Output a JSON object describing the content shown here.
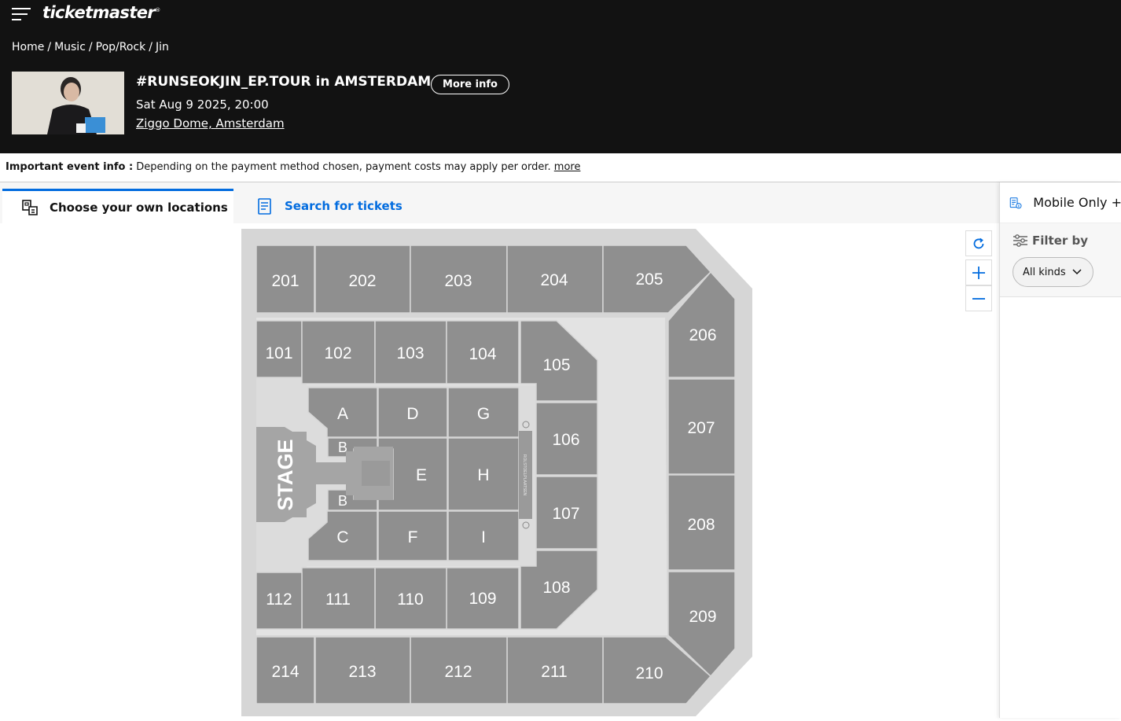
{
  "header": {
    "logo_text": "ticketmaster",
    "logo_reg": "®",
    "breadcrumb": [
      "Home",
      "Music",
      "Pop/Rock",
      "Jin"
    ],
    "event_title": "#RUNSEOKJIN_EP.TOUR in AMSTERDAM",
    "more_info_label": "More info",
    "event_date": "Sat Aug 9 2025, 20:00",
    "event_venue": "Ziggo Dome, Amsterdam"
  },
  "info_bar": {
    "label": "Important event info :",
    "text": " Depending on the payment method chosen, payment costs may apply per order. ",
    "link": "more"
  },
  "tabs": [
    {
      "label": "Choose your own locations",
      "active": true
    },
    {
      "label": "Search for tickets",
      "active": false
    }
  ],
  "right_panel": {
    "top_label": "Mobile Only +",
    "filter_label": "Filter by",
    "filter_value": "All kinds"
  },
  "colors": {
    "header_bg": "#121212",
    "accent": "#026cdf",
    "section_fill": "#8f8f8f",
    "floor_fill": "#d6d6d6"
  },
  "seat_map": {
    "stage_label": "STAGE",
    "side_label": "ROLSTOELPLAATSEN",
    "sections": {
      "s201": "201",
      "s202": "202",
      "s203": "203",
      "s204": "204",
      "s205": "205",
      "s206": "206",
      "s207": "207",
      "s208": "208",
      "s209": "209",
      "s210": "210",
      "s211": "211",
      "s212": "212",
      "s213": "213",
      "s214": "214",
      "s101": "101",
      "s102": "102",
      "s103": "103",
      "s104": "104",
      "s105": "105",
      "s106": "106",
      "s107": "107",
      "s108": "108",
      "s109": "109",
      "s110": "110",
      "s111": "111",
      "s112": "112",
      "A": "A",
      "B": "B",
      "C": "C",
      "D": "D",
      "E": "E",
      "F": "F",
      "G": "G",
      "H": "H",
      "I": "I"
    }
  }
}
